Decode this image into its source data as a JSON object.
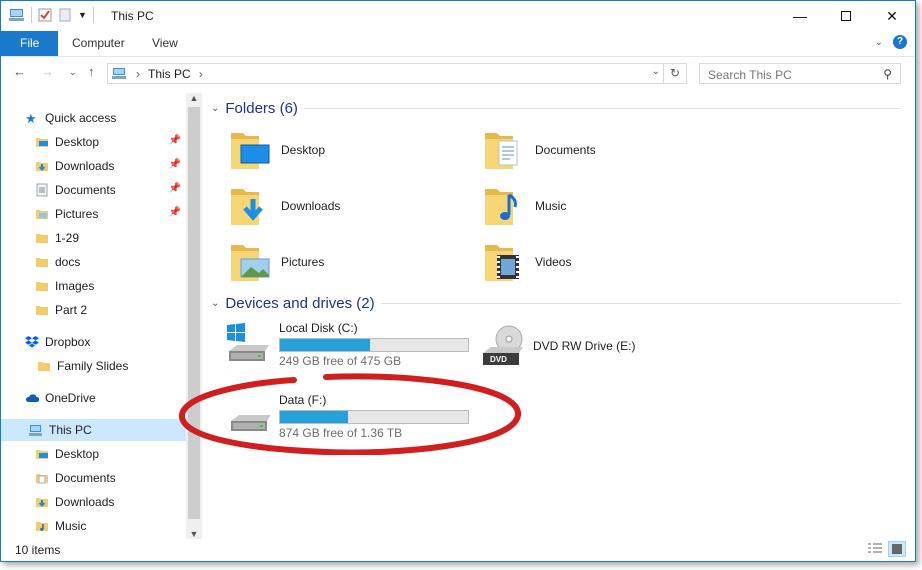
{
  "window": {
    "title": "This PC"
  },
  "ribbon": {
    "tabs": [
      "File",
      "Computer",
      "View"
    ]
  },
  "address": {
    "path": "This PC",
    "search_placeholder": "Search This PC"
  },
  "nav": {
    "quick_access": "Quick access",
    "qa_items": [
      "Desktop",
      "Downloads",
      "Documents",
      "Pictures",
      "1-29",
      "docs",
      "Images",
      "Part 2"
    ],
    "dropbox": "Dropbox",
    "dropbox_items": [
      "Family Slides"
    ],
    "onedrive": "OneDrive",
    "thispc": "This PC",
    "pc_items": [
      "Desktop",
      "Documents",
      "Downloads",
      "Music"
    ]
  },
  "folders": {
    "header": "Folders (6)",
    "items": [
      "Desktop",
      "Documents",
      "Downloads",
      "Music",
      "Pictures",
      "Videos"
    ]
  },
  "devices": {
    "header": "Devices and drives (2)",
    "drives": [
      {
        "name": "Local Disk (C:)",
        "free": "249 GB free of 475 GB",
        "used_fraction": 0.48
      },
      {
        "name": "DVD RW Drive (E:)"
      },
      {
        "name": "Data (F:)",
        "free": "874 GB free of 1.36 TB",
        "used_fraction": 0.36
      }
    ]
  },
  "status": {
    "count": "10 items"
  },
  "colors": {
    "accent": "#1979ca",
    "progress": "#26a0da",
    "highlight_ring": "#d11f1f"
  }
}
